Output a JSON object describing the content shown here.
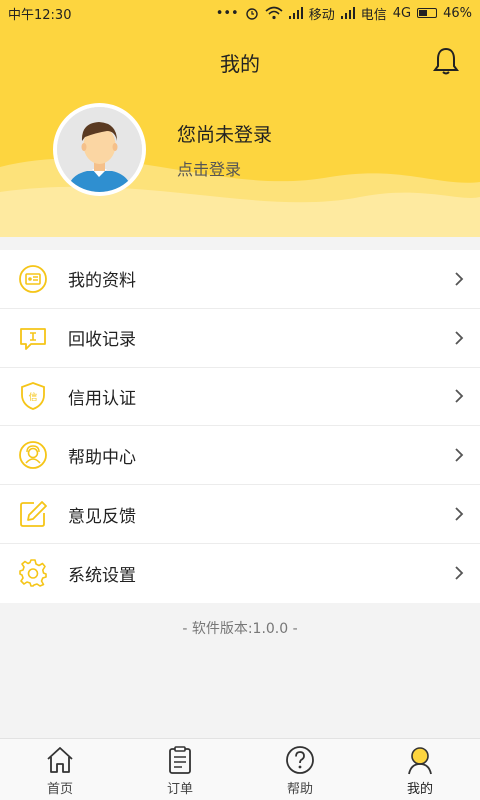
{
  "status_bar": {
    "time": "中午12:30",
    "dots": "•••",
    "carrier1": "移动",
    "carrier2": "电信",
    "network": "4G",
    "battery": "46%",
    "battery_level": 0.46
  },
  "header": {
    "title": "我的",
    "user_name": "您尚未登录",
    "login_prompt": "点击登录"
  },
  "menu": {
    "items": [
      {
        "label": "我的资料",
        "icon": "profile-card-icon"
      },
      {
        "label": "回收记录",
        "icon": "recycle-record-icon"
      },
      {
        "label": "信用认证",
        "icon": "credit-shield-icon"
      },
      {
        "label": "帮助中心",
        "icon": "help-center-icon"
      },
      {
        "label": "意见反馈",
        "icon": "feedback-edit-icon"
      },
      {
        "label": "系统设置",
        "icon": "settings-gear-icon"
      }
    ]
  },
  "version_text": "- 软件版本:1.0.0 -",
  "tabbar": {
    "tabs": [
      {
        "label": "首页",
        "icon": "home-icon"
      },
      {
        "label": "订单",
        "icon": "order-icon"
      },
      {
        "label": "帮助",
        "icon": "help-icon"
      },
      {
        "label": "我的",
        "icon": "me-icon",
        "active": true
      }
    ]
  },
  "colors": {
    "accent": "#fdd53f",
    "icon_yellow": "#f5c518",
    "background": "#f3f3f3"
  }
}
